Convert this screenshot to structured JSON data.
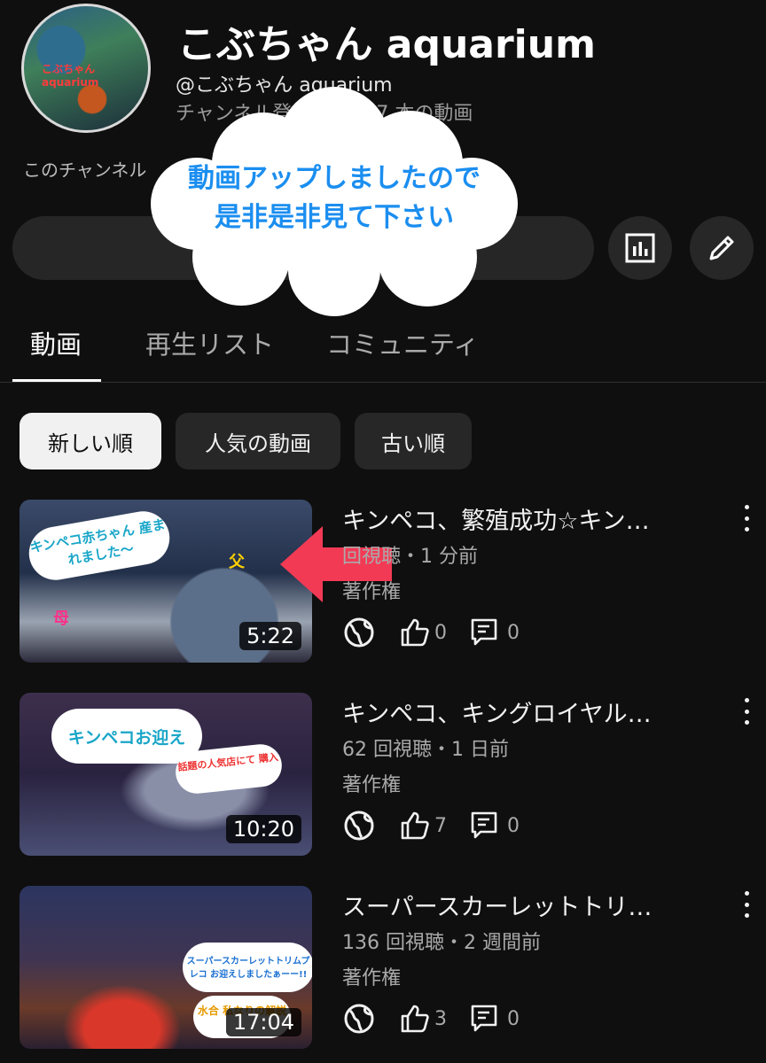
{
  "channel": {
    "name": "こぶちゃん aquarium",
    "handle": "@こぶちゃん aquarium",
    "stats": "チャンネル登録者数  ・7 本の動画",
    "description": "このチャンネル",
    "avatar_text": "こぶちゃん aquarium"
  },
  "overlay": {
    "line1": "動画アップしましたので",
    "line2": "是非是非見て下さい"
  },
  "buttons": {
    "analytics_icon": "bar-chart-icon",
    "edit_icon": "pencil-icon"
  },
  "tabs": [
    {
      "label": "動画"
    },
    {
      "label": "再生リスト"
    },
    {
      "label": "コミュニティ"
    }
  ],
  "chips": [
    {
      "label": "新しい順"
    },
    {
      "label": "人気の動画"
    },
    {
      "label": "古い順"
    }
  ],
  "videos": [
    {
      "title": "キンペコ、繁殖成功☆キン…",
      "meta": "回視聴・1 分前",
      "rights": "著作権",
      "duration": "5:22",
      "likes": "0",
      "comments": "0",
      "bubble": "キンペコ赤ちゃん 産まれました〜",
      "label_father": "父",
      "label_mother": "母"
    },
    {
      "title": "キンペコ、キングロイヤル…",
      "meta": "62 回視聴・1 日前",
      "rights": "著作権",
      "duration": "10:20",
      "likes": "7",
      "comments": "0",
      "bubble": "キンペコお迎え",
      "bubble2": "話題の人気店にて 購入"
    },
    {
      "title": "スーパースカーレットトリ…",
      "meta": "136 回視聴・2 週間前",
      "rights": "著作権",
      "duration": "17:04",
      "likes": "3",
      "comments": "0",
      "bubble": "スーパースカーレットトリムプレコ お迎えしましたぁーー!!",
      "bubble2": "水合 私なりの解説"
    }
  ],
  "colors": {
    "background": "#0f0f0f",
    "cloud_text": "#1b8ef0",
    "arrow": "#f23a55",
    "chip_active": "#f1f1f1"
  }
}
